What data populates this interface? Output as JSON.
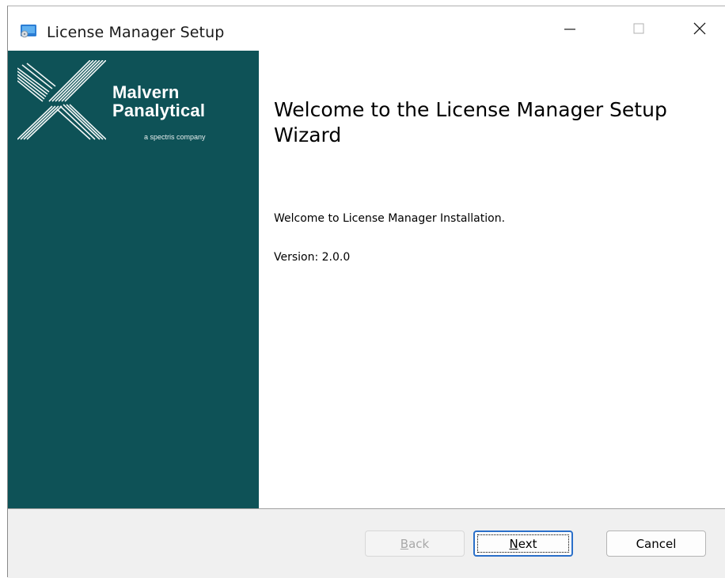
{
  "window": {
    "title": "License Manager Setup",
    "icon": "installer-icon",
    "controls": {
      "minimize": "minimize-icon",
      "maximize": "maximize-icon",
      "close": "close-icon"
    }
  },
  "banner": {
    "logo_name": "Malvern\nPanalytical",
    "logo_tagline": "a spectris company",
    "background_color": "#0e5257"
  },
  "content": {
    "heading": "Welcome to the License Manager Setup Wizard",
    "welcome_text": "Welcome to License Manager Installation.",
    "version_text": "Version: 2.0.0"
  },
  "buttons": {
    "back": {
      "mnemonic": "B",
      "rest": "ack",
      "enabled": false
    },
    "next": {
      "mnemonic": "N",
      "rest": "ext",
      "focused": true
    },
    "cancel": {
      "label": "Cancel"
    }
  },
  "colors": {
    "focus_border": "#2a6fc9",
    "footer_background": "#f0f0f0"
  }
}
